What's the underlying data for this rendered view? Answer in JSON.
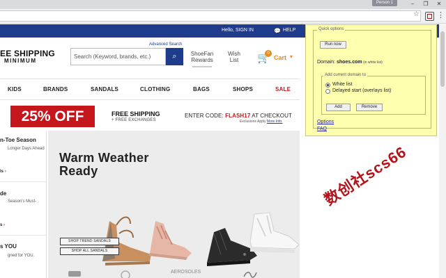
{
  "browser": {
    "profile_label": "Person 1",
    "window_buttons": {
      "minimize": "–",
      "maximize": "❐",
      "close": "✕"
    }
  },
  "site": {
    "topbar": {
      "left_text": "",
      "hello": "Hello, SIGN IN",
      "help": "HELP"
    },
    "header": {
      "free_shipping_line1": "EE SHIPPING",
      "free_shipping_line2": "MINIMUM",
      "advanced_search": "Advanced Search",
      "search_placeholder": "Search (Keyword, brands, etc.)",
      "shoefan_line1": "ShoeFan",
      "shoefan_line2": "Rewards",
      "wish_line1": "Wish",
      "wish_line2": "List",
      "cart_count": "0",
      "cart_label": "Cart"
    },
    "nav": [
      "KIDS",
      "BRANDS",
      "SANDALS",
      "CLOTHING",
      "BAGS",
      "SHOPS",
      "SALE"
    ],
    "promo": {
      "discount": "25% OFF",
      "free_shipping": "FREE SHIPPING",
      "free_exchanges": "+ FREE EXCHANGES",
      "code_prefix": "ENTER CODE: ",
      "code": "FLASH17",
      "code_suffix": " AT CHECKOUT",
      "exclusions": "Exclusions Apply ",
      "more_info": "More Info."
    },
    "left_column": [
      {
        "title": "n-Toe Season",
        "sub": "Longer Days Ahead",
        "link": "ls"
      },
      {
        "title": "de",
        "sub": "Season's Must-",
        "link": "s"
      },
      {
        "title": "s YOU",
        "sub": "gned for YOU.",
        "link": ""
      }
    ],
    "hero": {
      "title_line1": "Warm Weather",
      "title_line2": "Ready",
      "btn_trend": "SHOP TREND SANDALS",
      "btn_all": "SHOP ALL SANDALS"
    },
    "bottom_logos": [
      "AEROSOLES"
    ]
  },
  "extension_popup": {
    "legend": "Quick options",
    "run_now": "Run now",
    "domain_prefix": "Domain: ",
    "domain": "shoes.com",
    "domain_note": " (in white list)",
    "add_domain_legend": "Add current domain to",
    "options": [
      {
        "label": "White list",
        "selected": true
      },
      {
        "label": "Delayed start (overlays list)",
        "selected": false
      }
    ],
    "add": "Add",
    "remove": "Remove",
    "link_options": "Options",
    "link_faq": "FAQ"
  },
  "watermark": "数创社scs66",
  "colors": {
    "brand_blue": "#1f3b8c",
    "sale_red": "#c4161c",
    "cart_orange": "#e98a1a",
    "popup_yellow": "#ffffb0"
  }
}
